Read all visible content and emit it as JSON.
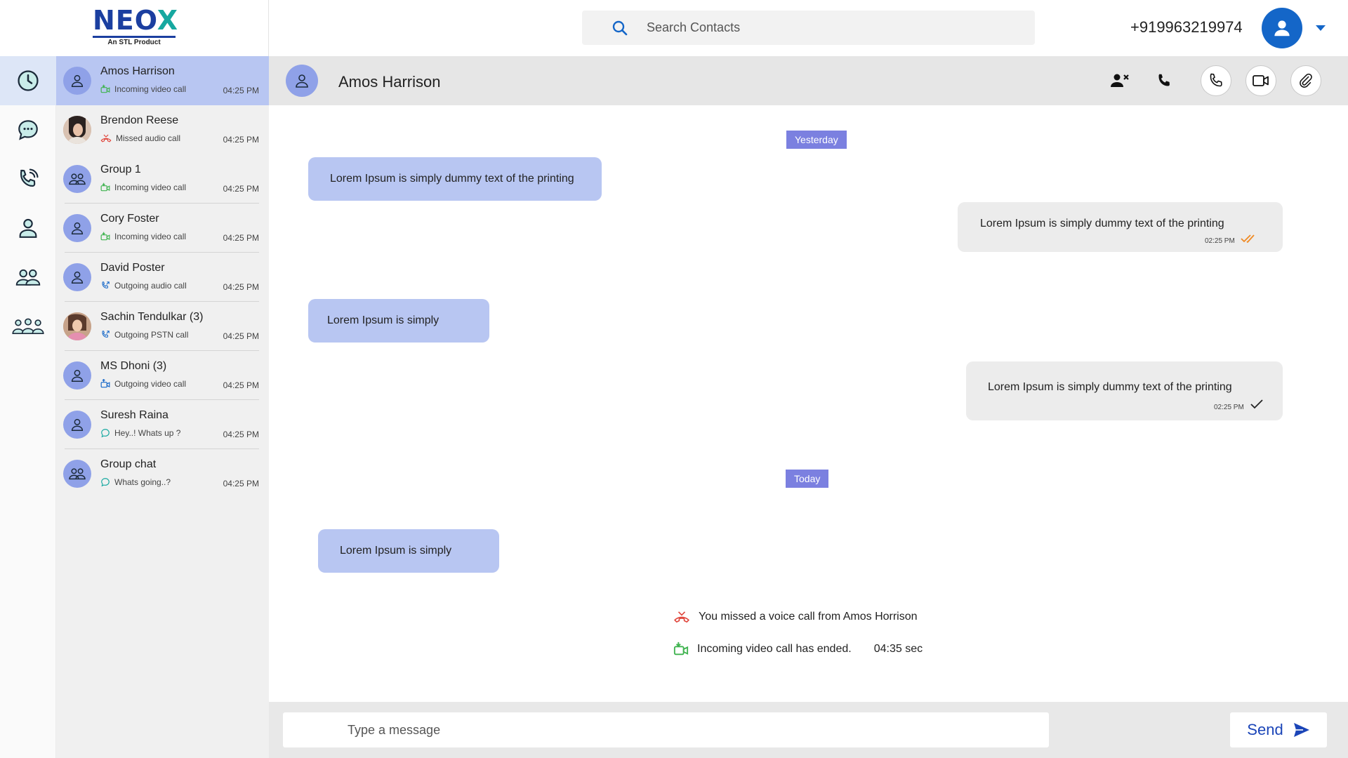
{
  "brand": {
    "logo_main": "NEO",
    "logo_accent": "X",
    "tagline": "An STL Product"
  },
  "header": {
    "search_placeholder": "Search Contacts",
    "phone_number": "+919963219974"
  },
  "conversations": [
    {
      "name": "Amos Harrison",
      "status": "Incoming video call",
      "status_icon": "incoming-video-icon",
      "time": "04:25 PM",
      "avatar": "person"
    },
    {
      "name": "Brendon Reese",
      "status": "Missed audio call",
      "status_icon": "missed-call-icon",
      "time": "04:25 PM",
      "avatar": "photo"
    },
    {
      "name": "Group 1",
      "status": "Incoming video call",
      "status_icon": "incoming-video-icon",
      "time": "04:25 PM",
      "avatar": "group"
    },
    {
      "name": "Cory Foster",
      "status": "Incoming video call",
      "status_icon": "incoming-video-icon",
      "time": "04:25 PM",
      "avatar": "person"
    },
    {
      "name": "David Poster",
      "status": "Outgoing audio call",
      "status_icon": "outgoing-call-icon",
      "time": "04:25 PM",
      "avatar": "person"
    },
    {
      "name": "Sachin Tendulkar (3)",
      "status": "Outgoing PSTN call",
      "status_icon": "outgoing-call-icon",
      "time": "04:25 PM",
      "avatar": "photo"
    },
    {
      "name": "MS Dhoni (3)",
      "status": "Outgoing video call",
      "status_icon": "outgoing-video-icon",
      "time": "04:25 PM",
      "avatar": "person"
    },
    {
      "name": "Suresh Raina",
      "status": "Hey..! Whats up ?",
      "status_icon": "chat-bubble-icon",
      "time": "04:25 PM",
      "avatar": "person"
    },
    {
      "name": "Group chat",
      "status": "Whats going..?",
      "status_icon": "chat-bubble-icon",
      "time": "04:25 PM",
      "avatar": "group"
    }
  ],
  "chat": {
    "contact_name": "Amos Harrison",
    "day_labels": {
      "yesterday": "Yesterday",
      "today": "Today"
    },
    "messages": [
      {
        "direction": "in",
        "text": "Lorem Ipsum is simply dummy text of the printing"
      },
      {
        "direction": "out",
        "text": "Lorem Ipsum is simply dummy text of the printing",
        "time": "02:25 PM",
        "receipt": "read"
      },
      {
        "direction": "in",
        "text": "Lorem Ipsum is simply"
      },
      {
        "direction": "out",
        "text": "Lorem Ipsum is simply dummy text of the printing",
        "time": "02:25 PM",
        "receipt": "sent"
      },
      {
        "direction": "in",
        "text": "Lorem Ipsum is simply"
      }
    ],
    "events": [
      {
        "text": "You missed a voice call from Amos Horrison",
        "icon": "missed-call-icon"
      },
      {
        "text": "Incoming video call has ended.",
        "duration": "04:35 sec",
        "icon": "incoming-video-icon"
      }
    ]
  },
  "composer": {
    "placeholder": "Type a message",
    "send_label": "Send"
  },
  "colors": {
    "accent": "#1466c8",
    "incoming_bubble": "#b8c6f2",
    "outgoing_bubble": "#ececec",
    "day_badge": "#7b80e0",
    "missed": "#e0463c",
    "incoming_call": "#3fb34f",
    "read_receipt": "#f08a24"
  }
}
